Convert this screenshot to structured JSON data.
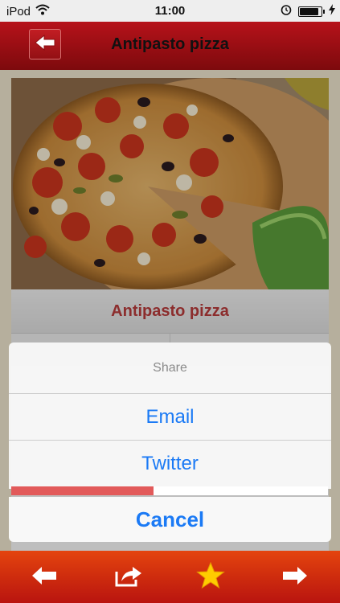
{
  "status_bar": {
    "carrier": "iPod",
    "time": "11:00",
    "battery_level": 0.9
  },
  "nav": {
    "title": "Antipasto pizza",
    "back_icon": "arrow-left-icon"
  },
  "recipe": {
    "title": "Antipasto pizza"
  },
  "share_sheet": {
    "title": "Share",
    "options": [
      {
        "label": "Email"
      },
      {
        "label": "Twitter"
      }
    ],
    "cancel_label": "Cancel",
    "progress": 0.45
  },
  "toolbar": {
    "items": [
      "previous-arrow-icon",
      "share-icon",
      "favorite-star-icon",
      "next-arrow-icon"
    ]
  },
  "colors": {
    "nav_red": "#9e0f14",
    "toolbar_orange": "#d0300e",
    "link_blue": "#1b7af5",
    "title_red": "#b43a3a",
    "star_yellow": "#ffcc00"
  }
}
